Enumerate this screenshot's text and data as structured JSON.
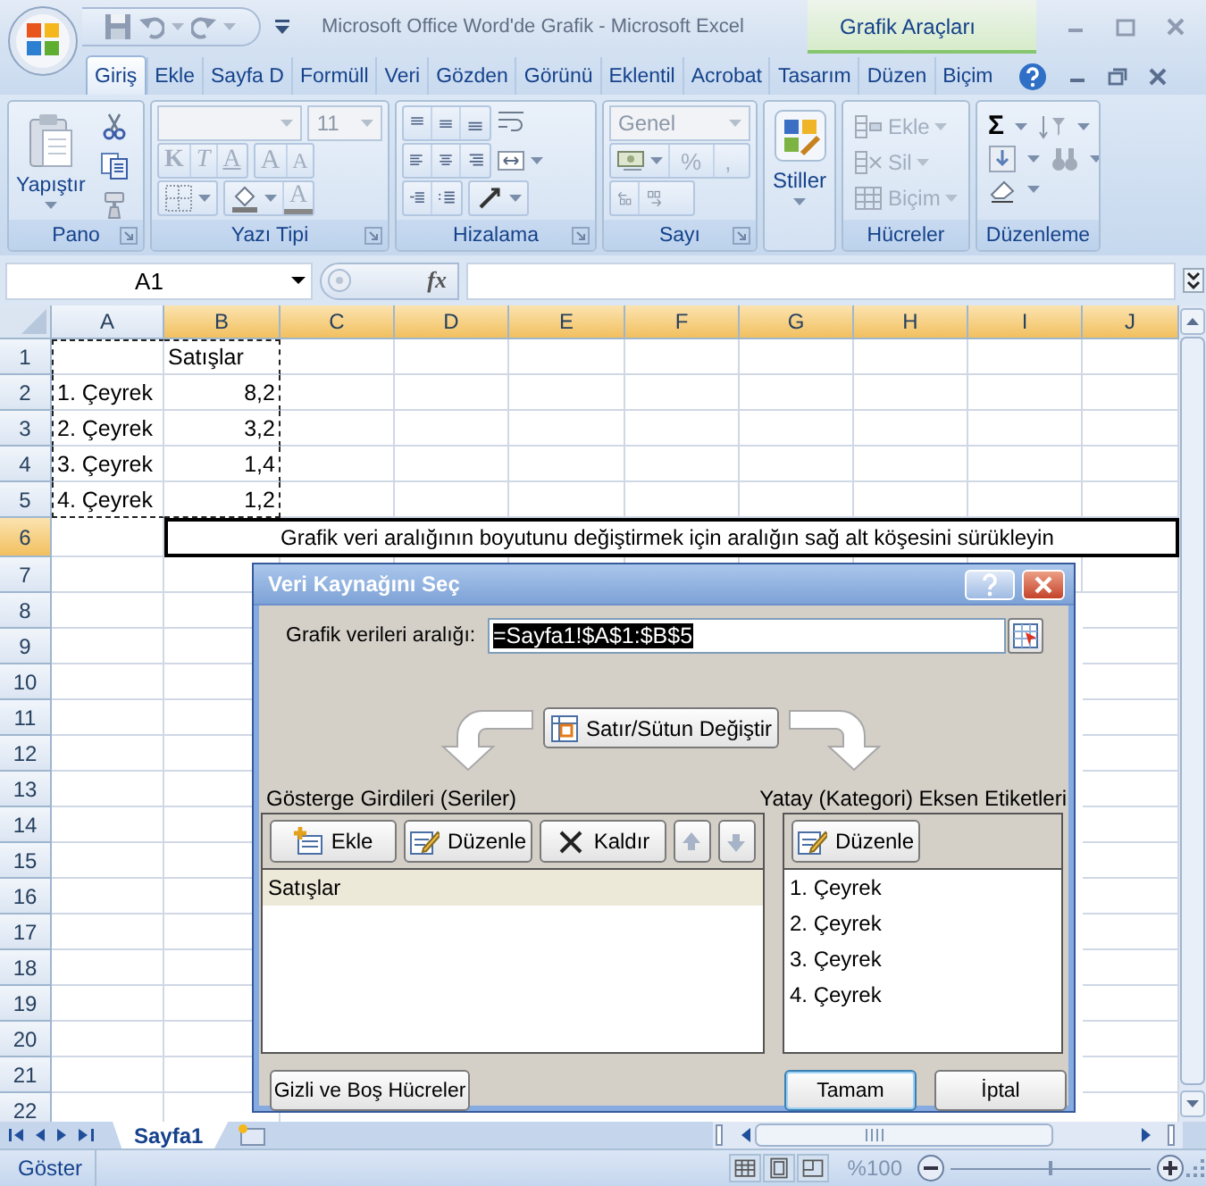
{
  "window": {
    "title": "Microsoft Office Word'de Grafik - Microsoft Excel",
    "context_title": "Grafik Araçları"
  },
  "tabs": [
    {
      "label": "Giriş",
      "selected": true
    },
    {
      "label": "Ekle",
      "selected": false
    },
    {
      "label": "Sayfa D",
      "selected": false
    },
    {
      "label": "Formüll",
      "selected": false
    },
    {
      "label": "Veri",
      "selected": false
    },
    {
      "label": "Gözden",
      "selected": false
    },
    {
      "label": "Görünü",
      "selected": false
    },
    {
      "label": "Eklentil",
      "selected": false
    },
    {
      "label": "Acrobat",
      "selected": false
    },
    {
      "label": "Tasarım",
      "selected": false
    },
    {
      "label": "Düzen",
      "selected": false
    },
    {
      "label": "Biçim",
      "selected": false
    }
  ],
  "ribbon": {
    "groups": [
      {
        "kind": "clipboard",
        "title": "Pano",
        "paste_label": "Yapıştır"
      },
      {
        "kind": "font",
        "title": "Yazı Tipi",
        "font_size": "11",
        "style_buttons": [
          "K",
          "T",
          "A"
        ],
        "size_buttons": [
          "A",
          "A"
        ],
        "color_button": "A"
      },
      {
        "kind": "alignment",
        "title": "Hizalama"
      },
      {
        "kind": "number",
        "title": "Sayı",
        "format": "Genel",
        "symbol_buttons": [
          "%",
          ","
        ]
      },
      {
        "kind": "styles",
        "label": "Stiller"
      },
      {
        "kind": "cells",
        "title": "Hücreler",
        "items": [
          {
            "kind": "insert",
            "label": "Ekle",
            "disabled": true
          },
          {
            "kind": "delete",
            "label": "Sil",
            "disabled": true
          },
          {
            "kind": "format",
            "label": "Biçim",
            "disabled": true
          }
        ]
      },
      {
        "kind": "editing",
        "title": "Düzenleme",
        "symbol": "Σ"
      }
    ]
  },
  "formula_bar": {
    "name_box": "A1",
    "function_label": "fx"
  },
  "sheet": {
    "columns": [
      {
        "label": "A",
        "selected": false
      },
      {
        "label": "B",
        "selected": true
      },
      {
        "label": "C",
        "selected": true
      },
      {
        "label": "D",
        "selected": true
      },
      {
        "label": "E",
        "selected": true
      },
      {
        "label": "F",
        "selected": true
      },
      {
        "label": "G",
        "selected": true
      },
      {
        "label": "H",
        "selected": true
      },
      {
        "label": "I",
        "selected": true
      },
      {
        "label": "J",
        "selected": true
      }
    ],
    "rows": [
      {
        "label": "1",
        "selected": false,
        "cells": [
          {
            "kind": "text",
            "in_range": true
          },
          {
            "kind": "text",
            "text": "Satışlar",
            "in_range": true
          }
        ]
      },
      {
        "label": "2",
        "selected": false,
        "cells": [
          {
            "kind": "text",
            "text": "1. Çeyrek",
            "in_range": true
          },
          {
            "kind": "number",
            "text": "8,2",
            "in_range": true
          }
        ]
      },
      {
        "label": "3",
        "selected": false,
        "cells": [
          {
            "kind": "text",
            "text": "2. Çeyrek",
            "in_range": true
          },
          {
            "kind": "number",
            "text": "3,2",
            "in_range": true
          }
        ]
      },
      {
        "label": "4",
        "selected": false,
        "cells": [
          {
            "kind": "text",
            "text": "3. Çeyrek",
            "in_range": true
          },
          {
            "kind": "number",
            "text": "1,4",
            "in_range": true
          }
        ]
      },
      {
        "label": "5",
        "selected": false,
        "cells": [
          {
            "kind": "text",
            "text": "4. Çeyrek",
            "in_range": true
          },
          {
            "kind": "number",
            "text": "1,2",
            "in_range": true
          }
        ]
      },
      {
        "label": "6",
        "selected": true,
        "hint": "Grafik veri aralığının boyutunu değiştirmek için aralığın sağ alt köşesini sürükleyin"
      },
      {
        "label": "7",
        "selected": false
      },
      {
        "label": "8",
        "selected": false
      },
      {
        "label": "9",
        "selected": false
      },
      {
        "label": "10",
        "selected": false
      },
      {
        "label": "11",
        "selected": false
      },
      {
        "label": "12",
        "selected": false
      },
      {
        "label": "13",
        "selected": false
      },
      {
        "label": "14",
        "selected": false
      },
      {
        "label": "15",
        "selected": false
      },
      {
        "label": "16",
        "selected": false
      },
      {
        "label": "17",
        "selected": false
      },
      {
        "label": "18",
        "selected": false
      },
      {
        "label": "19",
        "selected": false
      },
      {
        "label": "20",
        "selected": false
      },
      {
        "label": "21",
        "selected": false
      },
      {
        "label": "22",
        "selected": false
      }
    ]
  },
  "sheet_tabs": [
    {
      "label": "Sayfa1",
      "selected": true
    }
  ],
  "status_bar": {
    "mode": "Göster",
    "zoom": "%100",
    "level": 0.5
  },
  "dialog": {
    "title": "Veri Kaynağını Seç",
    "range_label": "Grafik verileri aralığı:",
    "range_value": "=Sayfa1!$A$1:$B$5",
    "range_selected": true,
    "switch_button": "Satır/Sütun Değiştir",
    "series": {
      "heading": "Gösterge Girdileri (Seriler)",
      "buttons": [
        {
          "kind": "add",
          "label": "Ekle",
          "disabled": false
        },
        {
          "kind": "edit",
          "label": "Düzenle",
          "disabled": false
        },
        {
          "kind": "remove",
          "label": "Kaldır",
          "disabled": false
        },
        {
          "kind": "up",
          "disabled": true
        },
        {
          "kind": "down",
          "disabled": true
        }
      ],
      "items": [
        {
          "label": "Satışlar",
          "selected": true
        }
      ]
    },
    "categories": {
      "heading": "Yatay (Kategori) Eksen Etiketleri",
      "buttons": [
        {
          "kind": "edit",
          "label": "Düzenle",
          "disabled": false
        }
      ],
      "items": [
        {
          "label": "1. Çeyrek",
          "selected": false
        },
        {
          "label": "2. Çeyrek",
          "selected": false
        },
        {
          "label": "3. Çeyrek",
          "selected": false
        },
        {
          "label": "4. Çeyrek",
          "selected": false
        }
      ]
    },
    "buttons": [
      {
        "kind": "hidden_cells",
        "label": "Gizli ve Boş Hücreler",
        "default": false
      },
      {
        "kind": "ok",
        "label": "Tamam",
        "default": true
      },
      {
        "kind": "cancel",
        "label": "İptal",
        "default": false
      }
    ]
  }
}
